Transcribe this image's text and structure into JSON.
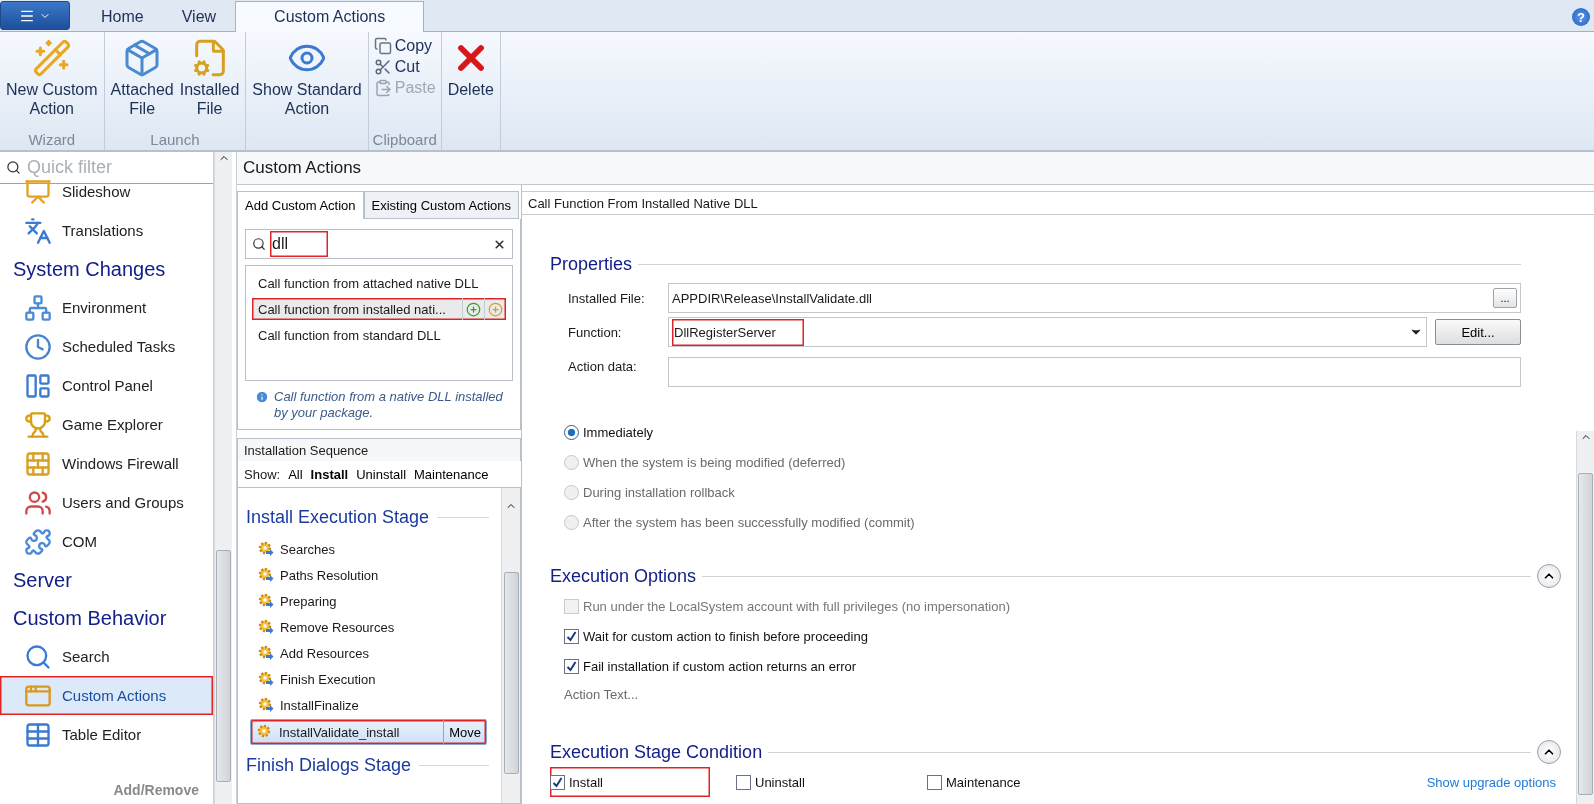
{
  "ribbon_tabs": [
    {
      "label": "Home",
      "selected": false
    },
    {
      "label": "View",
      "selected": false
    },
    {
      "label": "Custom Actions",
      "selected": true
    }
  ],
  "help": "?",
  "ribbon_groups": [
    {
      "label": "Wizard",
      "buttons": [
        {
          "kind": "large",
          "label": "New Custom\nAction",
          "disabled": false
        }
      ]
    },
    {
      "label": "Launch",
      "buttons": [
        {
          "kind": "large",
          "label": "Attached\nFile",
          "disabled": false
        },
        {
          "kind": "large",
          "label": "Installed\nFile",
          "disabled": false
        }
      ]
    },
    {
      "buttons": [
        {
          "kind": "large",
          "label": "Show Standard\nAction",
          "disabled": false
        }
      ]
    },
    {
      "label": "Clipboard",
      "buttons": [
        {
          "kind": "small",
          "label": "Copy",
          "disabled": false
        },
        {
          "kind": "small",
          "label": "Cut",
          "disabled": false
        },
        {
          "kind": "small",
          "label": "Paste",
          "disabled": true
        }
      ]
    },
    {
      "buttons": [
        {
          "kind": "large",
          "label": "Delete",
          "disabled": false
        }
      ]
    }
  ],
  "sidebar": {
    "filter_placeholder": "Quick filter",
    "footer": "Add/Remove",
    "entries": [
      {
        "kind": "item",
        "label": "Slideshow",
        "selected": false,
        "red_box": false
      },
      {
        "kind": "item",
        "label": "Translations",
        "selected": false,
        "red_box": false
      },
      {
        "kind": "heading",
        "label": "System Changes"
      },
      {
        "kind": "item",
        "label": "Environment",
        "selected": false,
        "red_box": false
      },
      {
        "kind": "item",
        "label": "Scheduled Tasks",
        "selected": false,
        "red_box": false
      },
      {
        "kind": "item",
        "label": "Control Panel",
        "selected": false,
        "red_box": false
      },
      {
        "kind": "item",
        "label": "Game Explorer",
        "selected": false,
        "red_box": false
      },
      {
        "kind": "item",
        "label": "Windows Firewall",
        "selected": false,
        "red_box": false
      },
      {
        "kind": "item",
        "label": "Users and Groups",
        "selected": false,
        "red_box": false
      },
      {
        "kind": "item",
        "label": "COM",
        "selected": false,
        "red_box": false
      },
      {
        "kind": "heading",
        "label": "Server"
      },
      {
        "kind": "heading",
        "label": "Custom Behavior"
      },
      {
        "kind": "item",
        "label": "Search",
        "selected": false,
        "red_box": false
      },
      {
        "kind": "item",
        "label": "Custom Actions",
        "selected": true,
        "red_box": true
      },
      {
        "kind": "item",
        "label": "Table Editor",
        "selected": false,
        "red_box": false
      }
    ]
  },
  "page_title": "Custom Actions",
  "add_panel": {
    "tabs": [
      {
        "label": "Add Custom Action",
        "selected": true
      },
      {
        "label": "Existing Custom Actions",
        "selected": false
      }
    ],
    "search": {
      "value": "dll",
      "red_box": true
    },
    "results": [
      {
        "label": "Call function from attached native DLL",
        "selected": false,
        "red_box": false
      },
      {
        "label": "Call function from installed nati...",
        "selected": true,
        "red_box": true
      },
      {
        "label": "Call function from standard DLL",
        "selected": false,
        "red_box": false
      }
    ],
    "note": "Call function from a native DLL installed by your package."
  },
  "sequence": {
    "title": "Installation Sequence",
    "show_label": "Show:",
    "filters": [
      {
        "label": "All",
        "selected": false
      },
      {
        "label": "Install",
        "selected": true
      },
      {
        "label": "Uninstall",
        "selected": false
      },
      {
        "label": "Maintenance",
        "selected": false
      }
    ],
    "entries": [
      {
        "kind": "stage",
        "label": "Install Execution Stage"
      },
      {
        "kind": "step",
        "label": "Searches",
        "selected": false,
        "red_box": false
      },
      {
        "kind": "step",
        "label": "Paths Resolution",
        "selected": false,
        "red_box": false
      },
      {
        "kind": "step",
        "label": "Preparing",
        "selected": false,
        "red_box": false
      },
      {
        "kind": "step",
        "label": "Remove Resources",
        "selected": false,
        "red_box": false
      },
      {
        "kind": "step",
        "label": "Add Resources",
        "selected": false,
        "red_box": false
      },
      {
        "kind": "step",
        "label": "Finish Execution",
        "selected": false,
        "red_box": false
      },
      {
        "kind": "step",
        "label": "InstallFinalize",
        "selected": false,
        "red_box": false
      },
      {
        "kind": "step",
        "label": "InstallValidate_install",
        "selected": true,
        "red_box": true,
        "button": "Move"
      },
      {
        "kind": "stage",
        "label": "Finish Dialogs Stage"
      }
    ]
  },
  "details": {
    "title": "Call Function From Installed Native DLL",
    "properties": {
      "title": "Properties",
      "fields": [
        {
          "kind": "browse",
          "label": "Installed File:",
          "value": "APPDIR\\Release\\InstallValidate.dll",
          "button": "...",
          "red_box": false
        },
        {
          "kind": "dropdown",
          "label": "Function:",
          "value": "DllRegisterServer",
          "button": "Edit...",
          "red_box": true
        },
        {
          "kind": "text",
          "label": "Action data:",
          "red_box": false
        }
      ]
    },
    "radios": [
      {
        "label": "Immediately",
        "selected": true,
        "disabled": false
      },
      {
        "label": "When the system is being modified (deferred)",
        "selected": false,
        "disabled": true
      },
      {
        "label": "During installation rollback",
        "selected": false,
        "disabled": true
      },
      {
        "label": "After the system has been successfully modified (commit)",
        "selected": false,
        "disabled": true
      }
    ],
    "execution_options": {
      "title": "Execution Options",
      "expanded": true,
      "link": "Action Text...",
      "checks": [
        {
          "label": "Run under the LocalSystem account with full privileges (no impersonation)",
          "checked": false,
          "disabled": true,
          "red_box": false
        },
        {
          "label": "Wait for custom action to finish before proceeding",
          "checked": true,
          "disabled": false,
          "red_box": false
        },
        {
          "label": "Fail installation if custom action returns an error",
          "checked": true,
          "disabled": false,
          "red_box": false
        }
      ]
    },
    "stage_condition": {
      "title": "Execution Stage Condition",
      "expanded": true,
      "link": "Show upgrade options",
      "checks": [
        {
          "label": "Install",
          "checked": true,
          "disabled": false,
          "red_box": true
        },
        {
          "label": "Uninstall",
          "checked": false,
          "disabled": false,
          "red_box": false
        },
        {
          "label": "Maintenance",
          "checked": false,
          "disabled": false,
          "red_box": false
        }
      ]
    }
  }
}
